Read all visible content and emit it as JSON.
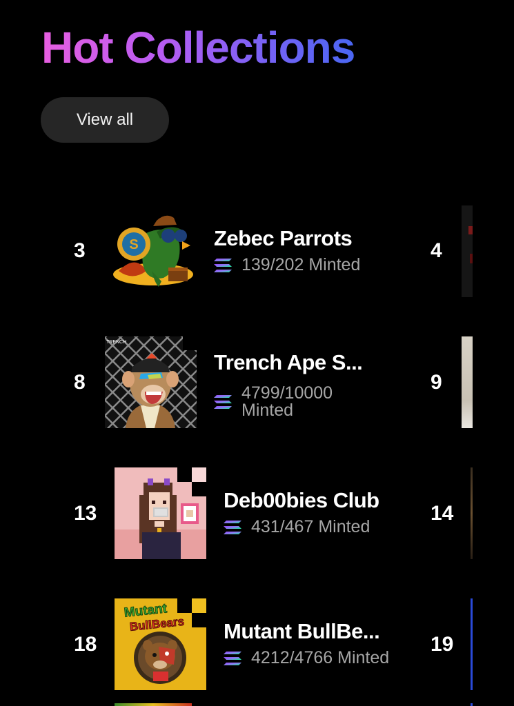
{
  "header": {
    "title": "Hot Collections",
    "view_all_label": "View all"
  },
  "collections": [
    {
      "rank": "3",
      "name": "Zebec Parrots",
      "minted": "139/202 Minted",
      "next_rank": "4"
    },
    {
      "rank": "8",
      "name": "Trench Ape S...",
      "minted": "4799/10000 Minted",
      "next_rank": "9"
    },
    {
      "rank": "13",
      "name": "Deb00bies Club",
      "minted": "431/467 Minted",
      "next_rank": "14"
    },
    {
      "rank": "18",
      "name": "Mutant BullBe...",
      "minted": "4212/4766 Minted",
      "next_rank": "19"
    }
  ],
  "icons": {
    "chain": "solana-icon",
    "thumb_1": "parrot-image",
    "thumb_2": "ape-image",
    "thumb_3": "pixel-girl-image",
    "thumb_4": "bullbear-image"
  },
  "colors": {
    "title_gradient": [
      "#e75ee0",
      "#b85cf2",
      "#7a62f5",
      "#4a66f2"
    ],
    "background": "#000000",
    "button_bg": "#262626",
    "minted_text": "#a6a6a6"
  }
}
